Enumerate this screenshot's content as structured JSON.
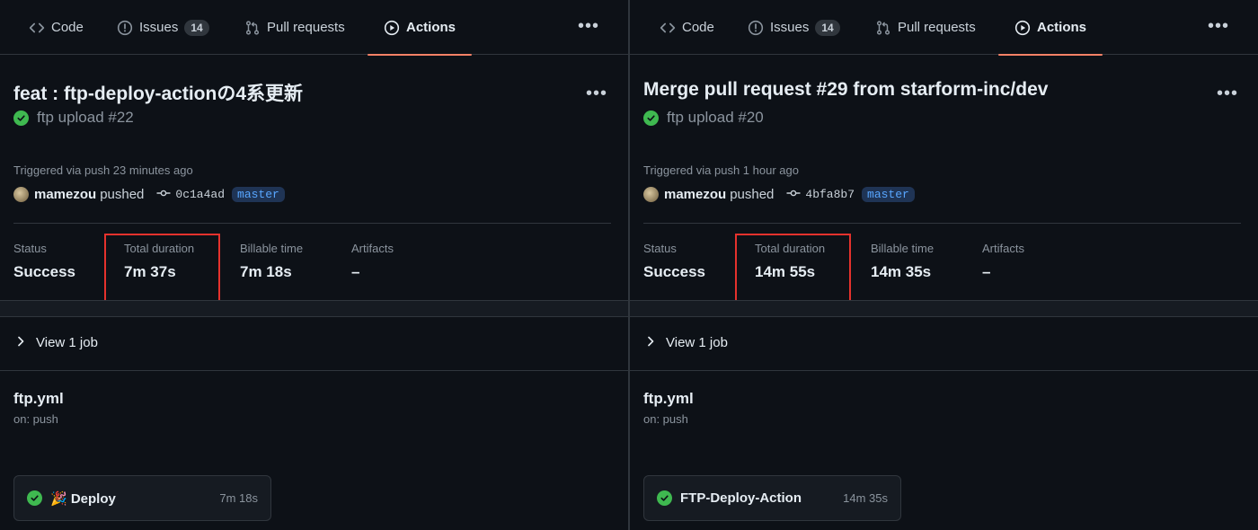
{
  "colors": {
    "background": "#0d1117",
    "accent_underline": "#f78166",
    "success": "#3fb950",
    "highlight_box": "#e5322d",
    "branch_text": "#58a6ff"
  },
  "panels": [
    {
      "nav": {
        "code": "Code",
        "issues": "Issues",
        "issues_count": "14",
        "pull_requests": "Pull requests",
        "actions": "Actions",
        "active_tab": "Actions"
      },
      "run": {
        "title": "feat : ftp-deploy-actionの4系更新",
        "subtitle": "ftp upload #22",
        "status_icon": "check-circle-icon",
        "triggered": "Triggered via push 23 minutes ago",
        "actor": "mamezou",
        "action": "pushed",
        "commit": "0c1a4ad",
        "branch": "master"
      },
      "stats": {
        "status_label": "Status",
        "status_value": "Success",
        "duration_label": "Total duration",
        "duration_value": "7m 37s",
        "billable_label": "Billable time",
        "billable_value": "7m 18s",
        "artifacts_label": "Artifacts",
        "artifacts_value": "–"
      },
      "view_job": "View 1 job",
      "workflow": {
        "name": "ftp.yml",
        "trigger": "on: push"
      },
      "job": {
        "name": "🎉 Deploy",
        "duration": "7m 18s"
      }
    },
    {
      "nav": {
        "code": "Code",
        "issues": "Issues",
        "issues_count": "14",
        "pull_requests": "Pull requests",
        "actions": "Actions",
        "active_tab": "Actions"
      },
      "run": {
        "title": "Merge pull request #29 from starform-inc/dev",
        "subtitle": "ftp upload #20",
        "status_icon": "check-circle-icon",
        "triggered": "Triggered via push 1 hour ago",
        "actor": "mamezou",
        "action": "pushed",
        "commit": "4bfa8b7",
        "branch": "master"
      },
      "stats": {
        "status_label": "Status",
        "status_value": "Success",
        "duration_label": "Total duration",
        "duration_value": "14m 55s",
        "billable_label": "Billable time",
        "billable_value": "14m 35s",
        "artifacts_label": "Artifacts",
        "artifacts_value": "–"
      },
      "view_job": "View 1 job",
      "workflow": {
        "name": "ftp.yml",
        "trigger": "on: push"
      },
      "job": {
        "name": "FTP-Deploy-Action",
        "duration": "14m 35s"
      }
    }
  ]
}
